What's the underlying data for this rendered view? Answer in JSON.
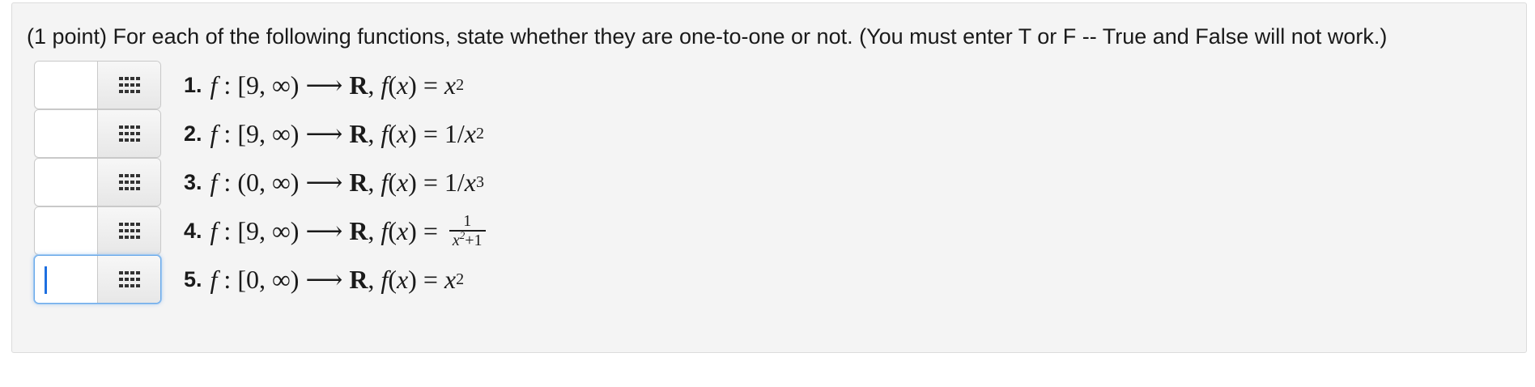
{
  "problem": {
    "prompt": "(1 point) For each of the following functions, state whether they are one-to-one or not. (You must enter T or F -- True and False will not work.)",
    "items": [
      {
        "number": "1.",
        "domain": "[9, ∞)",
        "codomain": "R",
        "formula": "x²",
        "answer": ""
      },
      {
        "number": "2.",
        "domain": "[9, ∞)",
        "codomain": "R",
        "formula": "1/x²",
        "answer": ""
      },
      {
        "number": "3.",
        "domain": "(0, ∞)",
        "codomain": "R",
        "formula": "1/x³",
        "answer": ""
      },
      {
        "number": "4.",
        "domain": "[9, ∞)",
        "codomain": "R",
        "formula": "1/(x²+1)",
        "answer": ""
      },
      {
        "number": "5.",
        "domain": "[0, ∞)",
        "codomain": "R",
        "formula": "x²",
        "answer": ""
      }
    ],
    "focused_item": 5
  },
  "colors": {
    "panel_bg": "#f4f4f4",
    "focus_blue": "#1e6fe0",
    "border": "#c9c9c9"
  },
  "icons": {
    "palette_button": "grid-icon"
  }
}
